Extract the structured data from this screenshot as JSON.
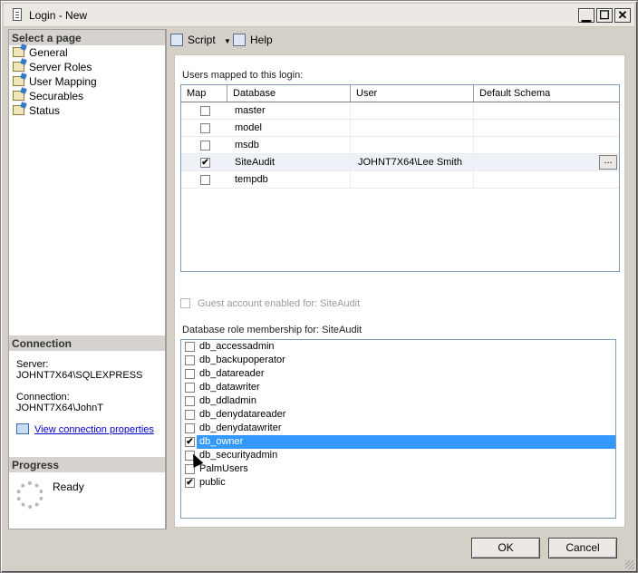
{
  "window": {
    "title": "Login - New"
  },
  "title_buttons": {
    "minimize": "▁",
    "maximize": "☐",
    "close": "✕"
  },
  "left_pane": {
    "select_page_header": "Select a page",
    "pages": [
      "General",
      "Server Roles",
      "User Mapping",
      "Securables",
      "Status"
    ],
    "connection_header": "Connection",
    "server_label": "Server:",
    "server_value": "JOHNT7X64\\SQLEXPRESS",
    "connection_label": "Connection:",
    "connection_value": "JOHNT7X64\\JohnT",
    "view_connection_link": "View connection properties",
    "progress_header": "Progress",
    "progress_status": "Ready"
  },
  "toolbar": {
    "script_label": "Script",
    "dropdown_glyph": "▼",
    "help_label": "Help"
  },
  "users_mapped": {
    "label": "Users mapped to this login:",
    "columns": [
      "Map",
      "Database",
      "User",
      "Default Schema"
    ],
    "rows": [
      {
        "checked": false,
        "database": "master",
        "user": "",
        "schema": ""
      },
      {
        "checked": false,
        "database": "model",
        "user": "",
        "schema": ""
      },
      {
        "checked": false,
        "database": "msdb",
        "user": "",
        "schema": ""
      },
      {
        "checked": true,
        "database": "SiteAudit",
        "user": "JOHNT7X64\\Lee Smith",
        "schema": ""
      },
      {
        "checked": false,
        "database": "tempdb",
        "user": "",
        "schema": ""
      }
    ],
    "ellipsis": "..."
  },
  "guest_account": {
    "label": "Guest account enabled for: SiteAudit",
    "checked": false
  },
  "roles": {
    "label": "Database role membership for: SiteAudit",
    "items": [
      {
        "name": "db_accessadmin",
        "checked": false
      },
      {
        "name": "db_backupoperator",
        "checked": false
      },
      {
        "name": "db_datareader",
        "checked": false
      },
      {
        "name": "db_datawriter",
        "checked": false
      },
      {
        "name": "db_ddladmin",
        "checked": false
      },
      {
        "name": "db_denydatareader",
        "checked": false
      },
      {
        "name": "db_denydatawriter",
        "checked": false
      },
      {
        "name": "db_owner",
        "checked": true
      },
      {
        "name": "db_securityadmin",
        "checked": false
      },
      {
        "name": "PalmUsers",
        "checked": false
      },
      {
        "name": "public",
        "checked": true
      }
    ]
  },
  "footer": {
    "ok_label": "OK",
    "cancel_label": "Cancel"
  },
  "check_glyph": "✔"
}
